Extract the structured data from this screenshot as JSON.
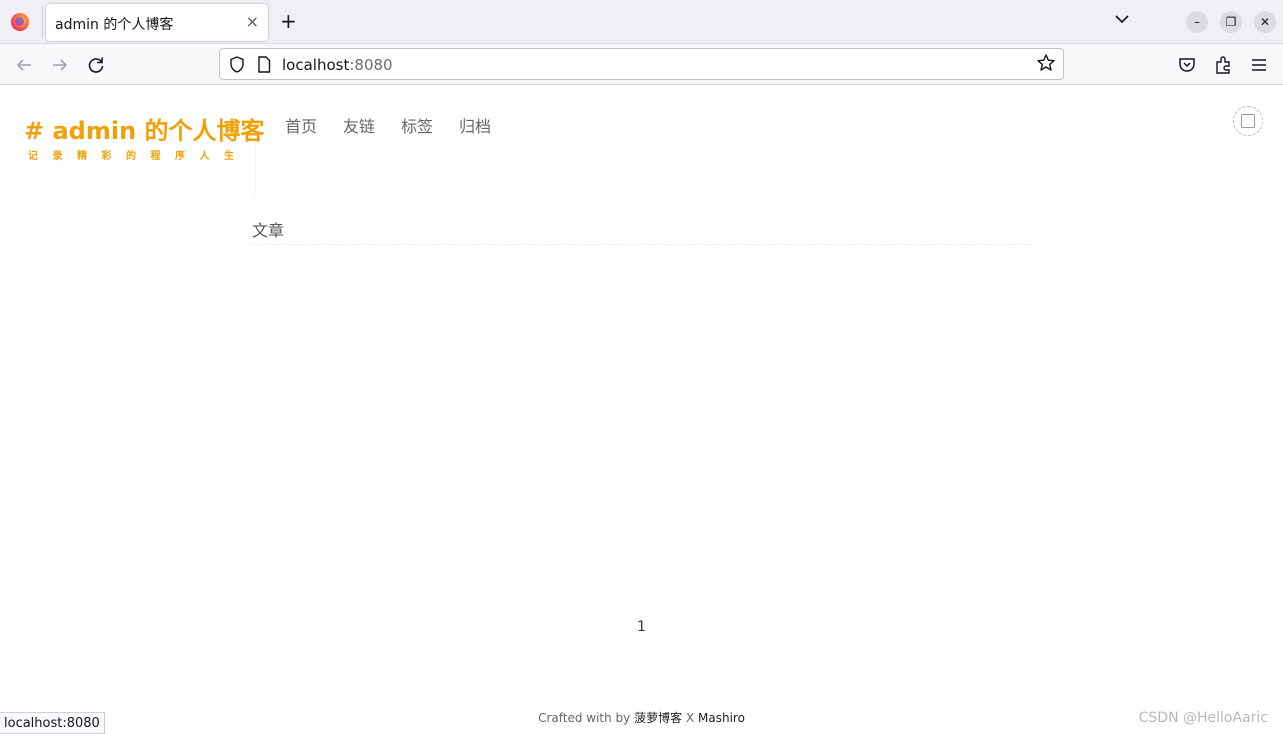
{
  "browser": {
    "tab_title": "admin 的个人博客",
    "tab_close": "×",
    "new_tab": "+",
    "url_host": "localhost",
    "url_port": ":8080",
    "icons": [
      "firefox-icon",
      "back-icon",
      "forward-icon",
      "reload-icon",
      "shield-icon",
      "page-icon",
      "star-icon",
      "pocket-icon",
      "extensions-icon",
      "menu-icon",
      "chevron-down-icon",
      "minimize-icon",
      "restore-icon",
      "close-icon"
    ],
    "window_buttons": {
      "minimize": "–",
      "restore": "❐",
      "close": "✕"
    }
  },
  "site": {
    "logo_title": "# admin 的个人博客",
    "logo_subtitle": "记录精彩的程序人生",
    "accent_color": "#f0a10a",
    "menu": [
      {
        "label": "首页"
      },
      {
        "label": "友链"
      },
      {
        "label": "标签"
      },
      {
        "label": "归档"
      }
    ]
  },
  "main": {
    "section_title": "文章",
    "pagination_current": "1"
  },
  "footer": {
    "prefix": "Crafted with by",
    "blog_name": "菠萝博客",
    "separator": "X",
    "theme": "Mashiro"
  },
  "watermark": "CSDN @HelloAaric",
  "status_bar": "localhost:8080"
}
